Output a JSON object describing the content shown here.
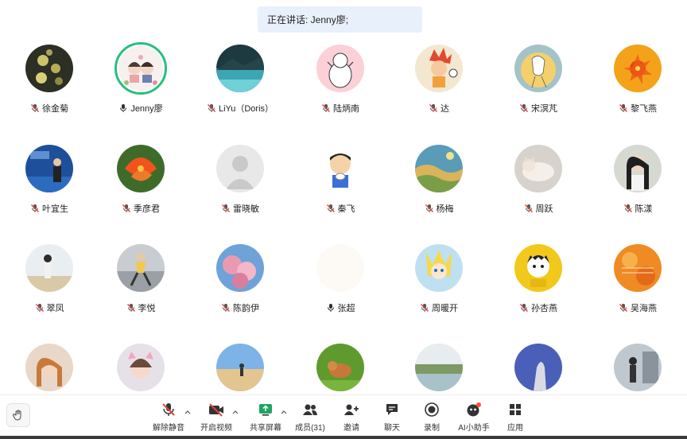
{
  "banner": {
    "speaking": "正在讲话: Jenny廖;"
  },
  "participants": [
    {
      "name": "徐金菊",
      "muted": true
    },
    {
      "name": "Jenny廖",
      "muted": false,
      "active": true
    },
    {
      "name": "LiYu（Doris）",
      "muted": true
    },
    {
      "name": "陆炳南",
      "muted": true
    },
    {
      "name": "达",
      "muted": true
    },
    {
      "name": "宋溟芃",
      "muted": true
    },
    {
      "name": "黎飞燕",
      "muted": true
    },
    {
      "name": "叶宜生",
      "muted": true
    },
    {
      "name": "季彦君",
      "muted": true
    },
    {
      "name": "雷晓敏",
      "muted": true
    },
    {
      "name": "秦飞",
      "muted": true
    },
    {
      "name": "杨梅",
      "muted": true
    },
    {
      "name": "周跃",
      "muted": true
    },
    {
      "name": "陈漾",
      "muted": true
    },
    {
      "name": "翠凤",
      "muted": true
    },
    {
      "name": "李悦",
      "muted": true
    },
    {
      "name": "陈韵伊",
      "muted": true
    },
    {
      "name": "张超",
      "muted": false
    },
    {
      "name": "周暖开",
      "muted": true
    },
    {
      "name": "孙杏燕",
      "muted": true
    },
    {
      "name": "吴海燕",
      "muted": true
    },
    {
      "name": "",
      "muted": true
    },
    {
      "name": "",
      "muted": true
    },
    {
      "name": "",
      "muted": true
    },
    {
      "name": "",
      "muted": true
    },
    {
      "name": "",
      "muted": true
    },
    {
      "name": "",
      "muted": true
    },
    {
      "name": "",
      "muted": true
    }
  ],
  "toolbar": {
    "unmute": "解除静音",
    "start_video": "开启视频",
    "share_screen": "共享屏幕",
    "members": "成员(31)",
    "invite": "邀请",
    "chat": "聊天",
    "record": "录制",
    "ai_assistant": "AI小助手",
    "apps": "应用"
  },
  "colors": {
    "active_ring": "#27c07d",
    "mute_red": "#e0433a",
    "share_green": "#1fa463",
    "ai_badge": "#ff4d3d"
  }
}
